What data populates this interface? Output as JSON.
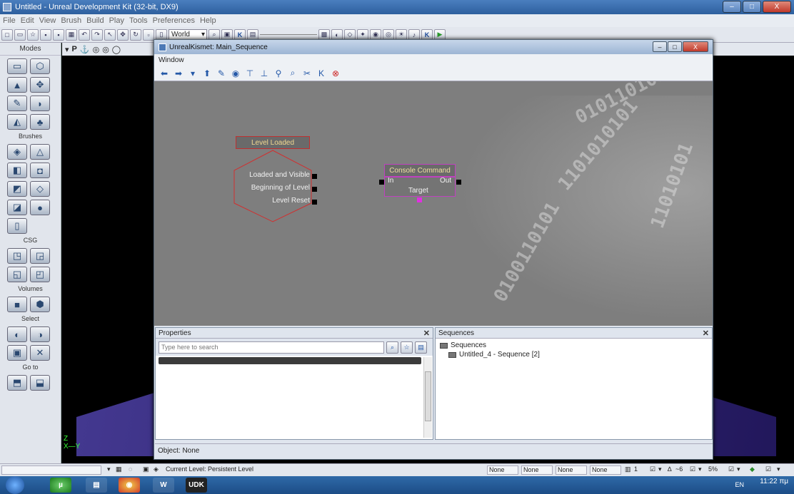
{
  "window": {
    "title": "Untitled - Unreal Development Kit (32-bit, DX9)",
    "min_label": "–",
    "max_label": "□",
    "close_label": "X"
  },
  "menu": [
    "File",
    "Edit",
    "View",
    "Brush",
    "Build",
    "Play",
    "Tools",
    "Preferences",
    "Help"
  ],
  "toolbar": {
    "world_label": "World",
    "k_label": "K",
    "play_label": "▶"
  },
  "modes": {
    "header": "Modes",
    "sections": {
      "brushes": "Brushes",
      "csg": "CSG",
      "volumes": "Volumes",
      "select": "Select",
      "goto": "Go to"
    }
  },
  "viewport": {
    "p_label": "P",
    "axis_x": "X",
    "axis_y": "Y",
    "axis_z": "Z"
  },
  "kismet": {
    "title": "UnrealKismet: Main_Sequence",
    "menu": "Window",
    "k_label": "K",
    "event_node": {
      "title": "Level Loaded",
      "outputs": [
        "Loaded and Visible",
        "Beginning of Level",
        "Level Reset"
      ]
    },
    "action_node": {
      "title": "Console Command",
      "input": "In",
      "output": "Out",
      "variable": "Target"
    },
    "binary_text": [
      "010110101",
      "1101010101",
      "0100110101",
      "11010101"
    ]
  },
  "properties": {
    "header": "Properties",
    "search_placeholder": "Type here to search",
    "close": "✕"
  },
  "sequences": {
    "header": "Sequences",
    "close": "✕",
    "root": "Sequences",
    "child": "Untitled_4 - Sequence [2]"
  },
  "kismet_status": "Object: None",
  "statusbar": {
    "current_level": "Current Level: Persistent Level",
    "boxes": [
      "None",
      "None",
      "None",
      "None"
    ],
    "grid": "1",
    "angle": "~6",
    "scale": "5%"
  },
  "taskbar": {
    "lang": "EN",
    "time": "11:22 πμ",
    "udk_label": "UDK",
    "word_label": "W"
  }
}
